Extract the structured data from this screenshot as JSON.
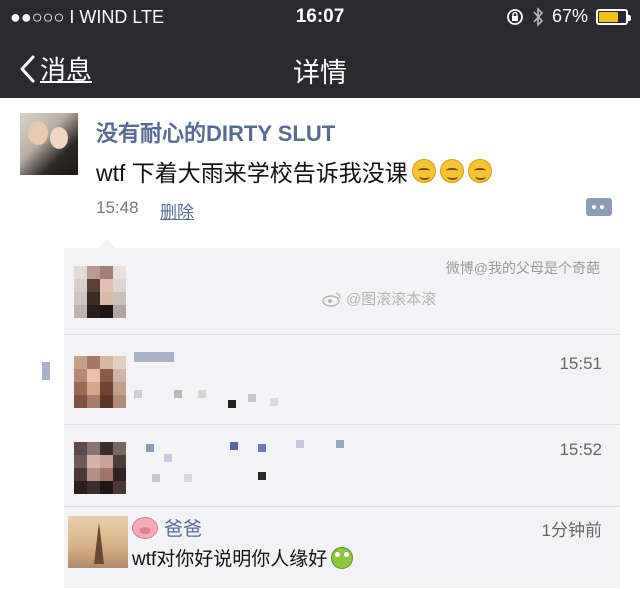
{
  "status_bar": {
    "carrier": "●●○○○ I WIND   LTE",
    "time": "16:07",
    "battery_percent": "67%",
    "battery_level": 0.67,
    "icons": [
      "lock-rotation-icon",
      "bluetooth-icon",
      "battery-icon"
    ]
  },
  "nav": {
    "back_label": "消息",
    "title": "详情"
  },
  "post": {
    "author": "没有耐心的DIRTY SLUT",
    "text": "wtf 下着大雨来学校告诉我没课",
    "emoji_count": 3,
    "time": "15:48",
    "delete_label": "删除"
  },
  "watermarks": {
    "top": "微博@我的父母是个奇葩",
    "center": "@图滚滚本滚"
  },
  "comments": {
    "times": [
      "15:51",
      "15:52"
    ],
    "reply": {
      "author": "爸爸",
      "time": "1分钟前",
      "text": "wtf对你好说明你人缘好"
    }
  },
  "colors": {
    "nav_bg": "#2b2b2f",
    "link": "#576b95",
    "comment_bg": "#f3f3f5",
    "battery": "#f0c21b"
  }
}
